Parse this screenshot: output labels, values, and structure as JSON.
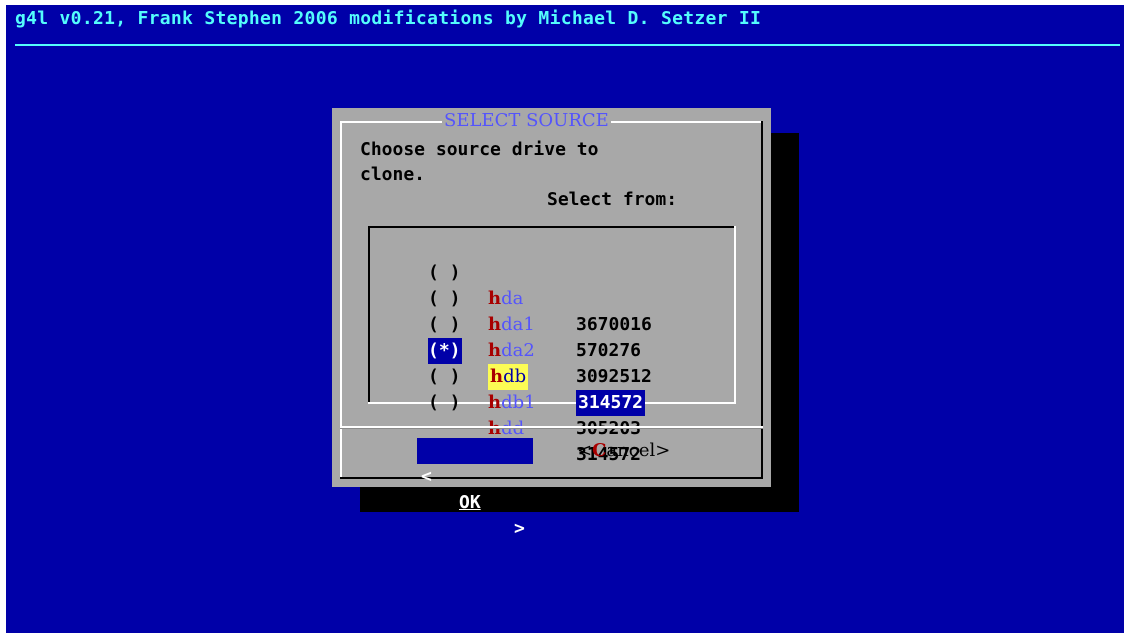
{
  "header": {
    "title": "g4l v0.21, Frank Stephen 2006 modifications by Michael D. Setzer II"
  },
  "dialog": {
    "title": "SELECT SOURCE",
    "prompt_line1": "Choose source drive to",
    "prompt_line2": "clone.",
    "list_heading": "Select from:",
    "items": [
      {
        "radio": "( )",
        "tag_hotkey": "h",
        "tag_rest": "da",
        "value": "3670016",
        "selected": false
      },
      {
        "radio": "( )",
        "tag_hotkey": "h",
        "tag_rest": "da1",
        "value": "570276",
        "selected": false
      },
      {
        "radio": "( )",
        "tag_hotkey": "h",
        "tag_rest": "da2",
        "value": "3092512",
        "selected": false
      },
      {
        "radio": "(*)",
        "tag_hotkey": "h",
        "tag_rest": "db",
        "value": "314572",
        "selected": true
      },
      {
        "radio": "( )",
        "tag_hotkey": "h",
        "tag_rest": "db1",
        "value": "305203",
        "selected": false
      },
      {
        "radio": "( )",
        "tag_hotkey": "h",
        "tag_rest": "dd",
        "value": "314572",
        "selected": false
      }
    ],
    "buttons": {
      "ok_left": "<",
      "ok_label": "OK",
      "ok_right": ">",
      "cancel_open": "<",
      "cancel_hotkey": "C",
      "cancel_rest": "ancel",
      "cancel_close": ">"
    }
  },
  "colors": {
    "screen_bg": "#0000a8",
    "dialog_bg": "#a8a8a8",
    "title_color": "#54fcfc",
    "hotkey_color": "#a80000",
    "tag_color": "#5454fc",
    "highlight": "#fcfc54"
  }
}
